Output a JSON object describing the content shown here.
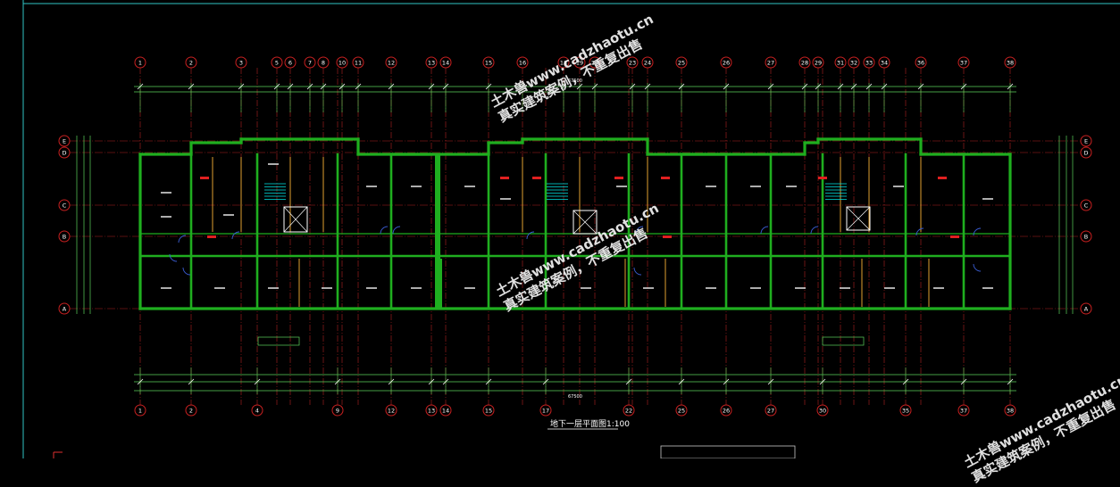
{
  "drawing": {
    "title": "地下一层平面图",
    "scale": "1:100",
    "colors": {
      "background": "#000000",
      "wall": "#1fae1f",
      "grid_line": "#d02a2a",
      "axis_bubble": "#c82020",
      "dimension": "#5cd35c",
      "text": "#ffffff",
      "frame": "#2fc5c5",
      "door": "#3b5fd8",
      "stair": "#00e5e5"
    },
    "top_axis_labels": [
      "1",
      "2",
      "3",
      "5",
      "6",
      "7",
      "8",
      "10",
      "11",
      "12",
      "13",
      "14",
      "15",
      "16",
      "18",
      "19",
      "20",
      "23",
      "24",
      "25",
      "26",
      "27",
      "28",
      "29",
      "31",
      "32",
      "33",
      "34",
      "36",
      "37",
      "38"
    ],
    "bottom_axis_labels": [
      "1",
      "2",
      "4",
      "9",
      "12",
      "13",
      "14",
      "15",
      "17",
      "22",
      "25",
      "26",
      "27",
      "30",
      "35",
      "37",
      "38"
    ],
    "side_axis_labels": [
      "E",
      "D",
      "C",
      "B",
      "A"
    ],
    "top_total_dimension": "67500",
    "bottom_total_dimension": "67500"
  },
  "watermarks": [
    {
      "line1": "土木兽www.cadzhaotu.cn",
      "line2": "真实建筑案例，不重复出售"
    },
    {
      "line1": "土木兽www.cadzhaotu.cn",
      "line2": "真实建筑案例，不重复出售"
    },
    {
      "line1": "土木兽www.cadzhaotu.cn",
      "line2": "真实建筑案例，不重复出售"
    }
  ]
}
